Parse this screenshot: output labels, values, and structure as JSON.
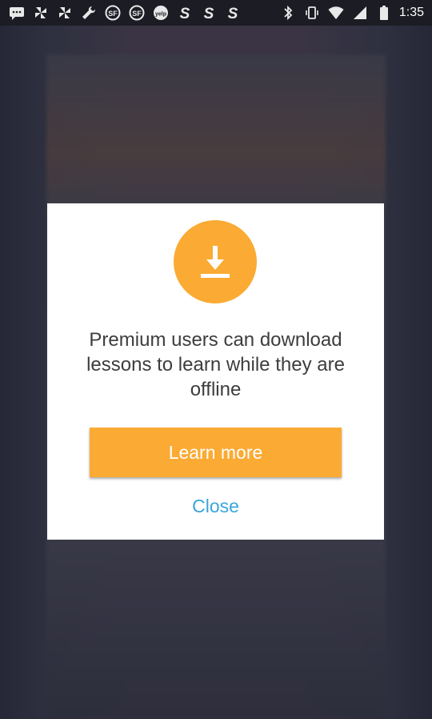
{
  "status_bar": {
    "left_icons": [
      "chat-icon",
      "pinwheel-icon",
      "pinwheel-icon",
      "wrench-icon",
      "sf-icon",
      "sf-icon",
      "yelp-icon",
      "s-icon",
      "s-icon",
      "s-icon"
    ],
    "time": "1:35"
  },
  "dialog": {
    "icon": "download-icon",
    "accent_color": "#fbaa33",
    "message": "Premium users can download lessons to learn while they are offline",
    "primary_button": "Learn more",
    "close_label": "Close",
    "close_color": "#3aa5dc"
  }
}
